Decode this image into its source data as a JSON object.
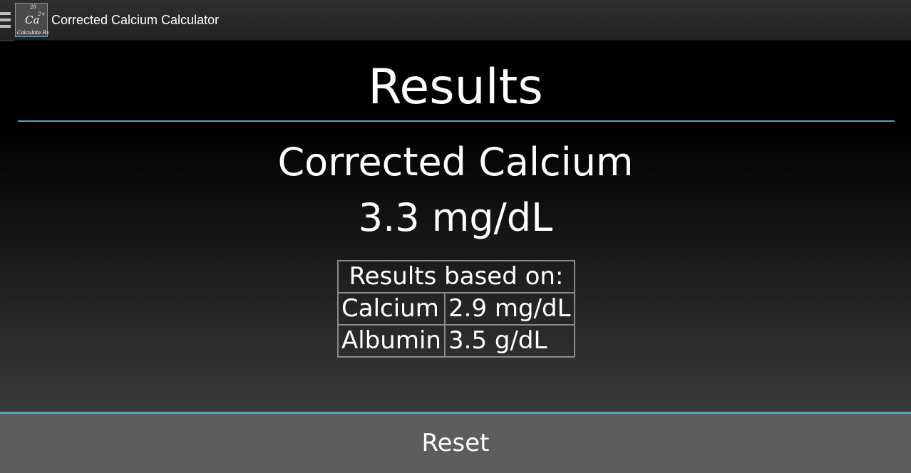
{
  "actionbar": {
    "title": "Corrected Calcium Calculator",
    "icon": {
      "atomic_number": "20",
      "symbol": "Ca",
      "charge": "2+",
      "brand": "Calculate Rx"
    }
  },
  "results": {
    "heading": "Results",
    "label": "Corrected Calcium",
    "value": "3.3 mg/dL"
  },
  "based_on": {
    "header": "Results based on:",
    "rows": [
      {
        "name": "Calcium",
        "value": "2.9 mg/dL"
      },
      {
        "name": "Albumin",
        "value": "3.5 g/dL"
      }
    ]
  },
  "reset": {
    "label": "Reset"
  },
  "colors": {
    "accent": "#4fa3c7",
    "button_bg": "#5d5d5d"
  },
  "icons": [
    "drawer-menu-icon",
    "app-icon"
  ]
}
